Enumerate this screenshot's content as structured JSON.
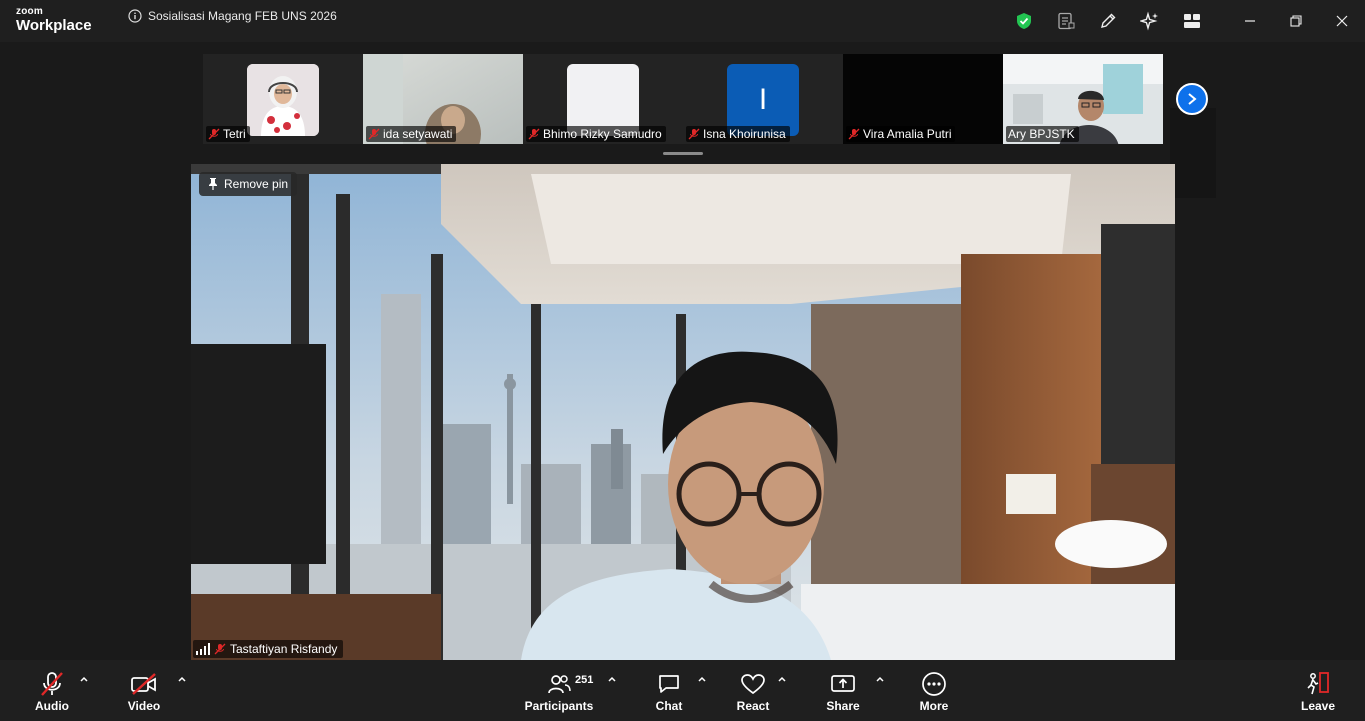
{
  "app": {
    "brand_top": "zoom",
    "brand_bottom": "Workplace"
  },
  "meeting": {
    "title": "Sosialisasi Magang FEB UNS 2026"
  },
  "colors": {
    "accent": "#0e71eb",
    "mic_off": "#e02828",
    "secure": "#23c552"
  },
  "thumbnails": [
    {
      "name": "Tetri"
    },
    {
      "name": "ida setyawati"
    },
    {
      "name": "Bhimo Rizky Samudro"
    },
    {
      "name": "Isna Khoirunisa",
      "avatar_letter": "I"
    },
    {
      "name": "Vira Amalia Putri"
    },
    {
      "name": "Ary BPJSTK"
    }
  ],
  "main": {
    "remove_pin_label": "Remove pin",
    "speaker_name": "Tastaftiyan Risfandy"
  },
  "toolbar": {
    "audio": "Audio",
    "video": "Video",
    "participants": "Participants",
    "participants_count": "251",
    "chat": "Chat",
    "react": "React",
    "share": "Share",
    "more": "More",
    "leave": "Leave"
  }
}
